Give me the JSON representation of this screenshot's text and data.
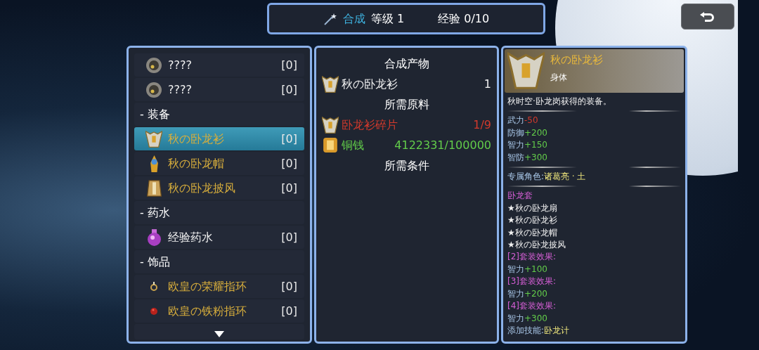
{
  "header": {
    "mode": "合成",
    "level": "等级 1",
    "exp": "经验 0/10"
  },
  "list": [
    {
      "kind": "item",
      "name": "????",
      "color": "#f1f1f1",
      "count": "[0]",
      "selected": false
    },
    {
      "kind": "item",
      "name": "????",
      "color": "#f1f1f1",
      "count": "[0]",
      "selected": false
    },
    {
      "kind": "category",
      "name": "- 装备"
    },
    {
      "kind": "item",
      "name": "秋の卧龙衫",
      "color": "#d8ae3c",
      "count": "[0]",
      "selected": true
    },
    {
      "kind": "item",
      "name": "秋の卧龙帽",
      "color": "#d8ae3c",
      "count": "[0]",
      "selected": false
    },
    {
      "kind": "item",
      "name": "秋の卧龙披风",
      "color": "#d8ae3c",
      "count": "[0]",
      "selected": false
    },
    {
      "kind": "category",
      "name": "- 药水"
    },
    {
      "kind": "item",
      "name": "经验药水",
      "color": "#f1f1f1",
      "count": "[0]",
      "selected": false
    },
    {
      "kind": "category",
      "name": "- 饰品"
    },
    {
      "kind": "item",
      "name": "欧皇の荣耀指环",
      "color": "#d8ae3c",
      "count": "[0]",
      "selected": false
    },
    {
      "kind": "item",
      "name": "欧皇の铁粉指环",
      "color": "#d8ae3c",
      "count": "[0]",
      "selected": false
    }
  ],
  "recipe": [
    {
      "kind": "heading",
      "text": "合成产物"
    },
    {
      "kind": "entry",
      "name": "秋の卧龙衫",
      "amount": "1",
      "color": "#f1f1f1"
    },
    {
      "kind": "heading",
      "text": "所需原料"
    },
    {
      "kind": "entry",
      "name": "卧龙衫碎片",
      "amount": "1/9",
      "color": "#d33a2c"
    },
    {
      "kind": "entry",
      "name": "铜钱",
      "amount": "4122331/100000",
      "color": "#62cc4a"
    },
    {
      "kind": "heading",
      "text": "所需条件"
    }
  ],
  "detail": {
    "name": "秋の卧龙衫",
    "slot": "身体",
    "lines": [
      {
        "kind": "text",
        "parts": [
          {
            "text": "秋时空·卧龙岗获得的装备。",
            "kind": "plain"
          }
        ]
      },
      {
        "kind": "divider"
      },
      {
        "kind": "text",
        "parts": [
          {
            "text": "武力",
            "kind": "label"
          },
          {
            "text": "-50",
            "kind": "penalty"
          }
        ]
      },
      {
        "kind": "text",
        "parts": [
          {
            "text": "防御",
            "kind": "label"
          },
          {
            "text": "+200",
            "kind": "bonus"
          }
        ]
      },
      {
        "kind": "text",
        "parts": [
          {
            "text": "智力",
            "kind": "label"
          },
          {
            "text": "+150",
            "kind": "bonus"
          }
        ]
      },
      {
        "kind": "text",
        "parts": [
          {
            "text": "智防",
            "kind": "label"
          },
          {
            "text": "+300",
            "kind": "bonus"
          }
        ]
      },
      {
        "kind": "divider"
      },
      {
        "kind": "text",
        "parts": [
          {
            "text": "专属角色:",
            "kind": "label"
          },
          {
            "text": "诸葛亮 · 土",
            "kind": "highlight"
          }
        ]
      },
      {
        "kind": "divider"
      },
      {
        "kind": "text",
        "parts": [
          {
            "text": "卧龙套",
            "kind": "set"
          }
        ]
      },
      {
        "kind": "text",
        "parts": [
          {
            "text": "★秋の卧龙扇",
            "kind": "plain"
          }
        ]
      },
      {
        "kind": "text",
        "parts": [
          {
            "text": "★秋の卧龙衫",
            "kind": "plain"
          }
        ]
      },
      {
        "kind": "text",
        "parts": [
          {
            "text": "★秋の卧龙帽",
            "kind": "plain"
          }
        ]
      },
      {
        "kind": "text",
        "parts": [
          {
            "text": "★秋の卧龙披风",
            "kind": "plain"
          }
        ]
      },
      {
        "kind": "text",
        "parts": [
          {
            "text": "[2]套装效果:",
            "kind": "set"
          }
        ]
      },
      {
        "kind": "text",
        "parts": [
          {
            "text": "智力",
            "kind": "label"
          },
          {
            "text": "+100",
            "kind": "bonus"
          }
        ]
      },
      {
        "kind": "text",
        "parts": [
          {
            "text": "[3]套装效果:",
            "kind": "set"
          }
        ]
      },
      {
        "kind": "text",
        "parts": [
          {
            "text": "智力",
            "kind": "label"
          },
          {
            "text": "+200",
            "kind": "bonus"
          }
        ]
      },
      {
        "kind": "text",
        "parts": [
          {
            "text": "[4]套装效果:",
            "kind": "set"
          }
        ]
      },
      {
        "kind": "text",
        "parts": [
          {
            "text": "智力",
            "kind": "label"
          },
          {
            "text": "+300",
            "kind": "bonus"
          }
        ]
      },
      {
        "kind": "text",
        "parts": [
          {
            "text": "添加技能:",
            "kind": "label"
          },
          {
            "text": "卧龙计",
            "kind": "highlight"
          }
        ]
      }
    ]
  }
}
